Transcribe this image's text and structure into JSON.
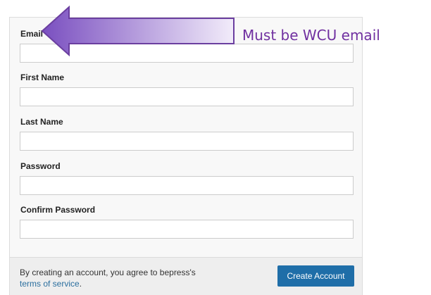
{
  "form": {
    "fields": [
      {
        "label": "Email",
        "value": "",
        "placeholder": ""
      },
      {
        "label": "First Name",
        "value": "",
        "placeholder": ""
      },
      {
        "label": "Last Name",
        "value": "",
        "placeholder": ""
      },
      {
        "label": "Password",
        "value": "",
        "placeholder": ""
      },
      {
        "label": "Confirm Password",
        "value": "",
        "placeholder": ""
      }
    ]
  },
  "footer": {
    "agreement_text": "By creating an account, you agree to bepress's ",
    "terms_link": "terms of service",
    "terms_suffix": ".",
    "create_button_label": "Create Account"
  },
  "annotation": {
    "text": "Must be WCU email",
    "arrow_icon": "left-arrow-icon",
    "text_color": "#7030a0",
    "arrow_fill_start": "#7a4fc0",
    "arrow_fill_end": "#f2ecfa"
  },
  "colors": {
    "button_bg": "#1f6ea8",
    "link": "#2a6e9e",
    "card_bg": "#f8f8f8",
    "footer_bg": "#eeeeee"
  }
}
